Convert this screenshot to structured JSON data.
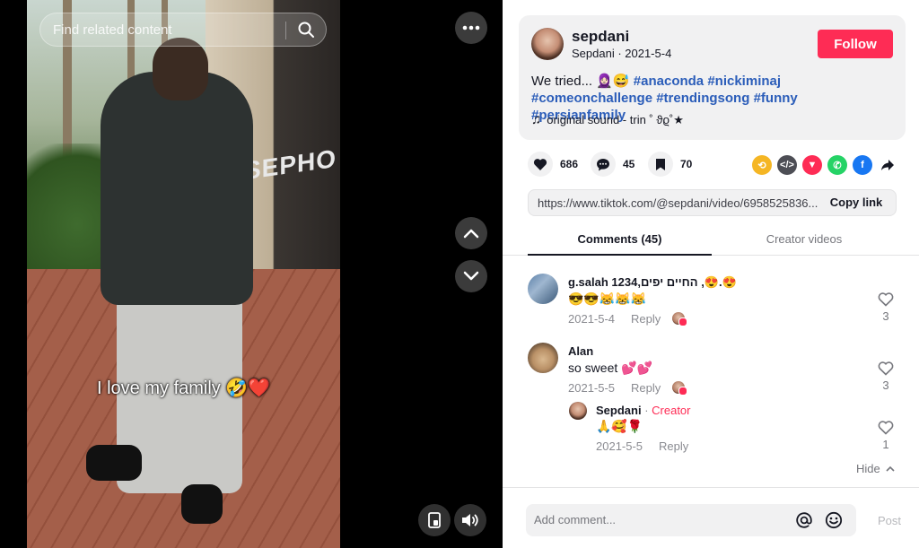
{
  "player": {
    "search_placeholder": "Find related content",
    "overlay_caption": "I love my family 🤣❤️",
    "sign_text": "SEPHO"
  },
  "post": {
    "author_username": "sepdani",
    "author_meta": "Sepdani · 2021-5-4",
    "follow_label": "Follow",
    "description_prefix": "We tried... 🧕🏻😅",
    "hashtags": [
      "#anaconda",
      "#nickiminaj",
      "#comeonchallenge",
      "#trendingsong",
      "#funny",
      "#persianfamily"
    ],
    "sound": "original sound - trin ˚ ϑϱ˚★"
  },
  "actions": {
    "likes": "686",
    "comments": "45",
    "saves": "70"
  },
  "share_icons": [
    "repost-icon",
    "embed-icon",
    "send-icon",
    "whatsapp-icon",
    "facebook-icon",
    "share-arrow-icon"
  ],
  "link": {
    "url": "https://www.tiktok.com/@sepdani/video/6958525836...",
    "copy_label": "Copy link"
  },
  "tabs": {
    "comments": "Comments (45)",
    "creator_videos": "Creator videos"
  },
  "comments": [
    {
      "name": "g.salah 1234,החיים יפים ,😍.😍",
      "text": "😎😎😹😹😹",
      "date": "2021-5-4",
      "reply_label": "Reply",
      "likes": "3"
    },
    {
      "name": "Alan",
      "text": "so sweet 💕💕",
      "date": "2021-5-5",
      "reply_label": "Reply",
      "likes": "3"
    }
  ],
  "reply": {
    "name": "Sepdani",
    "creator_label": "Creator",
    "text": "🙏🥰🌹",
    "date": "2021-5-5",
    "reply_label": "Reply",
    "likes": "1"
  },
  "hide_label": "Hide",
  "composer": {
    "placeholder": "Add comment...",
    "post_label": "Post"
  },
  "colors": {
    "accent": "#fe2c55",
    "hashtag": "#2b5db9"
  }
}
